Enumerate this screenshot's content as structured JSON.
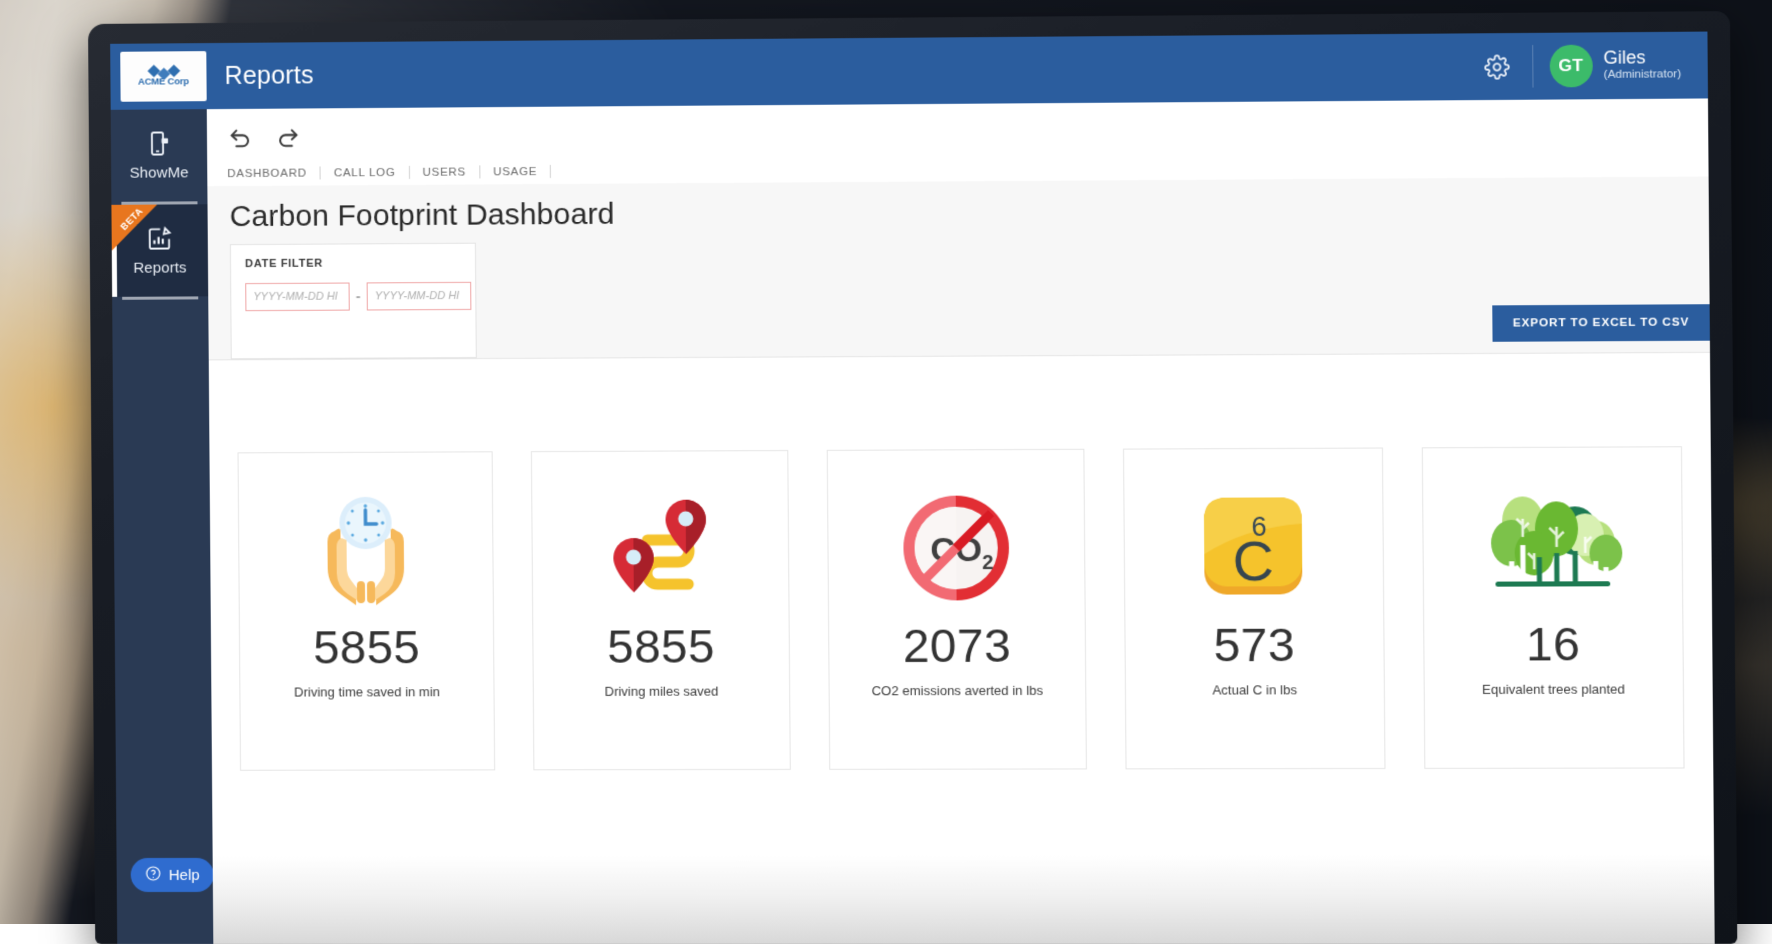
{
  "window": {
    "device": "desktop-monitor"
  },
  "topbar": {
    "logo_text": "ACME Corp",
    "app_title": "Reports",
    "gear_icon": "gear-icon",
    "user": {
      "initials": "GT",
      "name": "Giles",
      "role": "(Administrator)"
    }
  },
  "sidebar": {
    "items": [
      {
        "label": "ShowMe",
        "icon": "mobile-showme-icon",
        "active": false,
        "badge": ""
      },
      {
        "label": "Reports",
        "icon": "report-chart-icon",
        "active": true,
        "badge": "BETA"
      }
    ],
    "help": {
      "label": "Help",
      "icon": "question-circle-icon"
    }
  },
  "toolbar": {
    "undo_icon": "undo-icon",
    "redo_icon": "redo-icon"
  },
  "tabs": [
    {
      "label": "DASHBOARD",
      "active": true
    },
    {
      "label": "CALL LOG",
      "active": false
    },
    {
      "label": "USERS",
      "active": false
    },
    {
      "label": "USAGE",
      "active": false
    }
  ],
  "page": {
    "title": "Carbon Footprint Dashboard"
  },
  "date_filter": {
    "label": "DATE FILTER",
    "from_value": "",
    "from_placeholder": "YYYY-MM-DD HI",
    "separator": "-",
    "to_value": "",
    "to_placeholder": "YYYY-MM-DD HI"
  },
  "export": {
    "label": "EXPORT TO EXCEL TO CSV"
  },
  "metrics": [
    {
      "value": "5855",
      "label": "Driving time saved in min",
      "icon": "hands-holding-clock-icon"
    },
    {
      "value": "5855",
      "label": "Driving miles saved",
      "icon": "map-route-pins-icon"
    },
    {
      "value": "2073",
      "label": "CO2 emissions averted in lbs",
      "icon": "no-co2-icon"
    },
    {
      "value": "573",
      "label": "Actual C in lbs",
      "icon": "carbon-element-icon"
    },
    {
      "value": "16",
      "label": "Equivalent trees planted",
      "icon": "trees-forest-icon"
    }
  ],
  "colors": {
    "brand_blue": "#2b5d9e",
    "sidebar_navy": "#2a3a54",
    "sidebar_active": "#1f2c42",
    "beta_orange": "#e8761e",
    "avatar_green": "#3cbb6a",
    "date_input_border": "#efa6a6",
    "help_blue": "#2f6ccf"
  }
}
